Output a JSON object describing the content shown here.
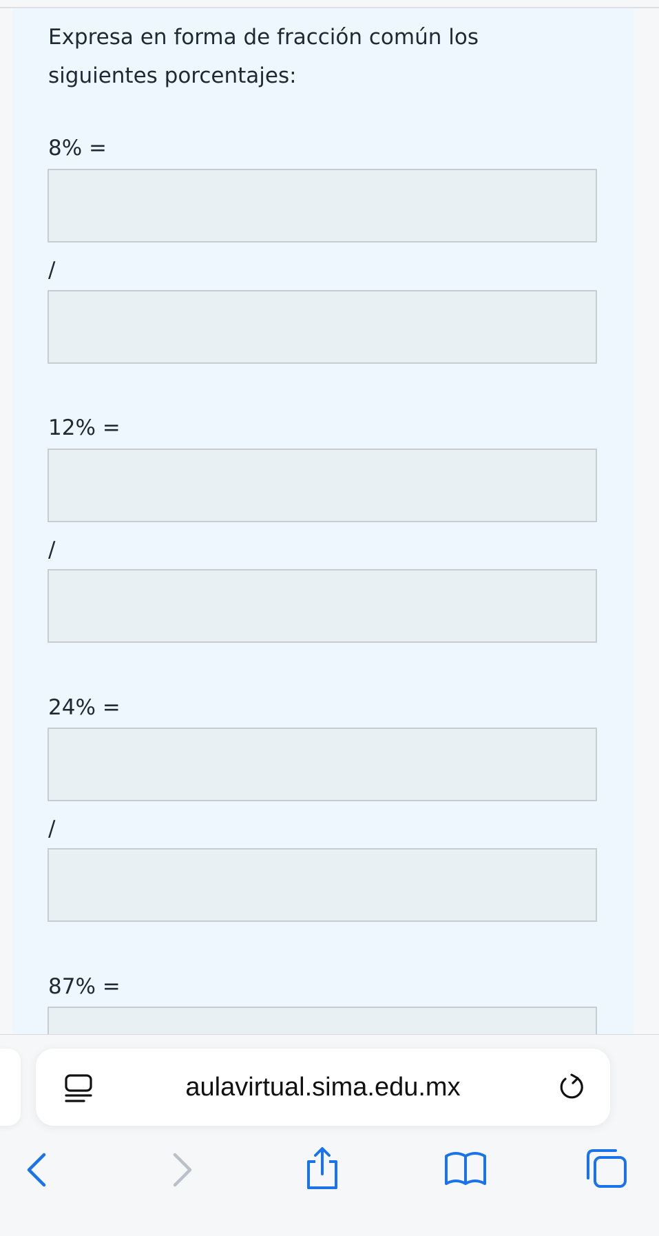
{
  "question": {
    "text": "Expresa en forma de fracción común los siguientes porcentajes:"
  },
  "items": [
    {
      "label": "8% =",
      "separator": "/",
      "numerator_value": "",
      "denominator_value": ""
    },
    {
      "label": "12% =",
      "separator": "/",
      "numerator_value": "",
      "denominator_value": ""
    },
    {
      "label": "24% =",
      "separator": "/",
      "numerator_value": "",
      "denominator_value": ""
    },
    {
      "label": "87% =",
      "separator": "/",
      "numerator_value": "",
      "denominator_value": ""
    }
  ],
  "browser": {
    "url": "aulavirtual.sima.edu.mx",
    "reader_icon": "reader-mode-icon",
    "reload_icon": "reload-icon",
    "accent_color": "#1a73e8",
    "toolbar_icons": [
      "back-arrow-icon",
      "forward-arrow-icon",
      "share-icon",
      "bookmarks-icon",
      "tabs-icon"
    ]
  },
  "colors": {
    "card_background": "#eff7fe",
    "input_background": "#e8f0f3",
    "input_border": "#c8cdd1"
  }
}
